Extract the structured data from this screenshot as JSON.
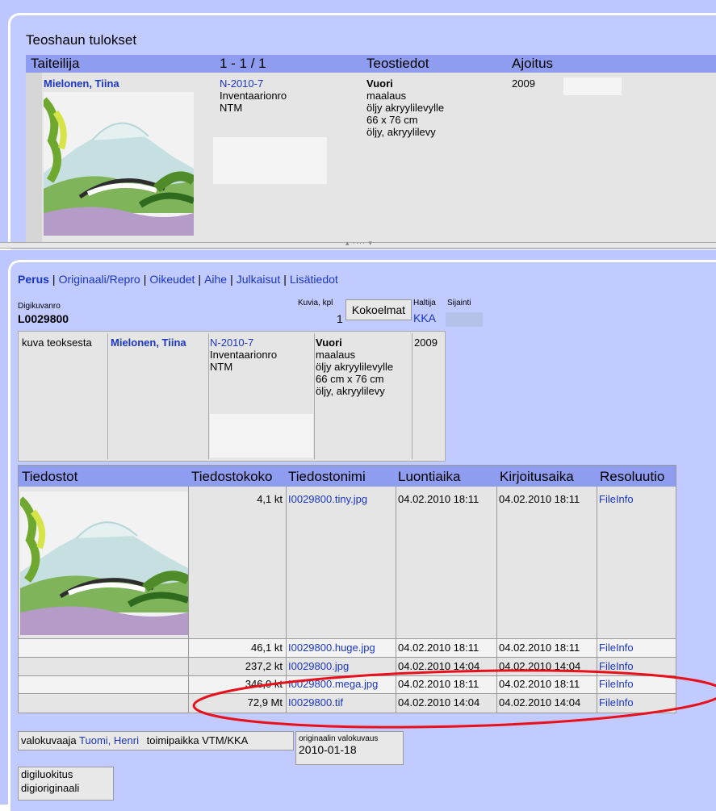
{
  "search": {
    "title": "Teoshaun tulokset",
    "headers": {
      "artist": "Taiteilija",
      "range": "1 - 1 / 1",
      "work_info": "Teostiedot",
      "timing": "Ajoitus"
    },
    "result": {
      "artist": "Mielonen, Tiina",
      "inventory_no": "N-2010-7",
      "inventory_label": "Inventaarionro",
      "collection": "NTM",
      "title": "Vuori",
      "type": "maalaus",
      "material": "öljy akryylilevylle",
      "size": "66 x 76 cm",
      "material2": "öljy, akryylilevy",
      "year": "2009"
    }
  },
  "tabs": [
    {
      "label": "Perus"
    },
    {
      "label": "Originaali/Repro"
    },
    {
      "label": "Oikeudet"
    },
    {
      "label": "Aihe"
    },
    {
      "label": "Julkaisut"
    },
    {
      "label": "Lisätiedot"
    }
  ],
  "tab_separator": "|",
  "detail": {
    "digi_label": "Digikuvanro",
    "digi_value": "L0029800",
    "kuvia_label": "Kuvia, kpl",
    "kuvia_value": "1",
    "kokoelmat_button": "Kokoelmat",
    "haltija_label": "Haltija",
    "haltija_value": "KKA",
    "sijainti_label": "Sijainti",
    "work": {
      "relation": "kuva teoksesta",
      "artist": "Mielonen, Tiina",
      "inventory_no": "N-2010-7",
      "inventory_label": "Inventaarionro",
      "collection": "NTM",
      "title": "Vuori",
      "type": "maalaus",
      "material": "öljy akryylilevylle",
      "size": "66 cm x 76 cm",
      "material2": "öljy, akryylilevy",
      "year": "2009"
    }
  },
  "files": {
    "headers": [
      "Tiedostot",
      "Tiedostokoko",
      "Tiedostonimi",
      "Luontiaika",
      "Kirjoitusaika",
      "Resoluutio"
    ],
    "rows": [
      {
        "size": "4,1 kt",
        "name": "I0029800.tiny.jpg",
        "created": "04.02.2010 18:11",
        "written": "04.02.2010 18:11",
        "res": "FileInfo"
      },
      {
        "size": "46,1 kt",
        "name": "I0029800.huge.jpg",
        "created": "04.02.2010 18:11",
        "written": "04.02.2010 18:11",
        "res": "FileInfo"
      },
      {
        "size": "237,2 kt",
        "name": "I0029800.jpg",
        "created": "04.02.2010 14:04",
        "written": "04.02.2010 14:04",
        "res": "FileInfo"
      },
      {
        "size": "346,0 kt",
        "name": "I0029800.mega.jpg",
        "created": "04.02.2010 18:11",
        "written": "04.02.2010 18:11",
        "res": "FileInfo"
      },
      {
        "size": "72,9 Mt",
        "name": "I0029800.tif",
        "created": "04.02.2010 14:04",
        "written": "04.02.2010 14:04",
        "res": "FileInfo"
      }
    ]
  },
  "photo": {
    "role": "valokuvaaja",
    "name": "Tuomi, Henri",
    "place_label": "toimipaikka",
    "place": "VTM/KKA",
    "orig_label": "originaalin valokuvaus",
    "orig_date": "2010-01-18"
  },
  "classification": {
    "line1": "digiluokitus",
    "line2": "digioriginaali"
  },
  "colors": {
    "header": "#8f9df0",
    "panel": "#c1cbff",
    "link": "#1a35c8",
    "annotation": "#e8101a"
  }
}
